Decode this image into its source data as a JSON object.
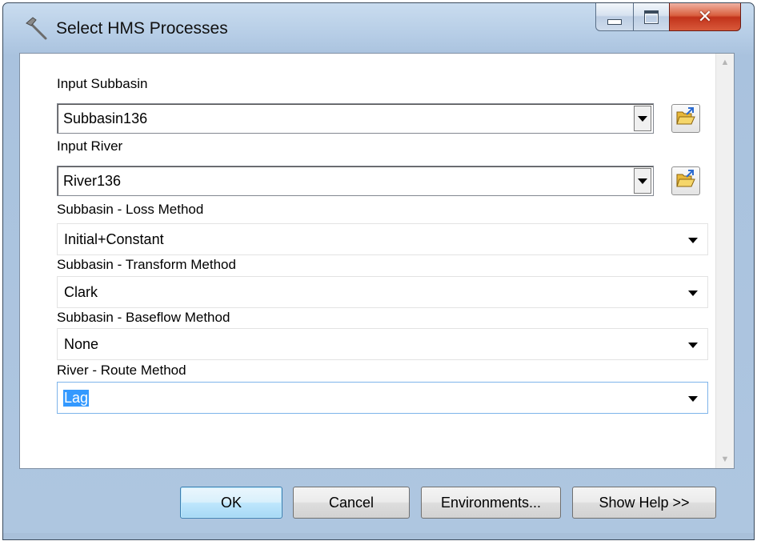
{
  "window": {
    "title": "Select HMS Processes",
    "controls": {
      "minimize": "minimize",
      "maximize": "maximize",
      "close": "close"
    }
  },
  "form": {
    "input_subbasin": {
      "label": "Input Subbasin",
      "value": "Subbasin136"
    },
    "input_river": {
      "label": "Input River",
      "value": "River136"
    },
    "loss_method": {
      "label": "Subbasin - Loss Method",
      "value": "Initial+Constant"
    },
    "transform_method": {
      "label": "Subbasin - Transform Method",
      "value": "Clark"
    },
    "baseflow_method": {
      "label": "Subbasin - Baseflow Method",
      "value": "None"
    },
    "route_method": {
      "label": "River - Route Method",
      "value": "Lag"
    }
  },
  "buttons": {
    "ok": "OK",
    "cancel": "Cancel",
    "environments": "Environments...",
    "show_help": "Show Help >>"
  },
  "icons": {
    "app": "hammer-icon",
    "browse": "open-folder-icon"
  },
  "colors": {
    "frame": "#b6cde6",
    "selection": "#3399ff",
    "close_button": "#c2331b"
  }
}
